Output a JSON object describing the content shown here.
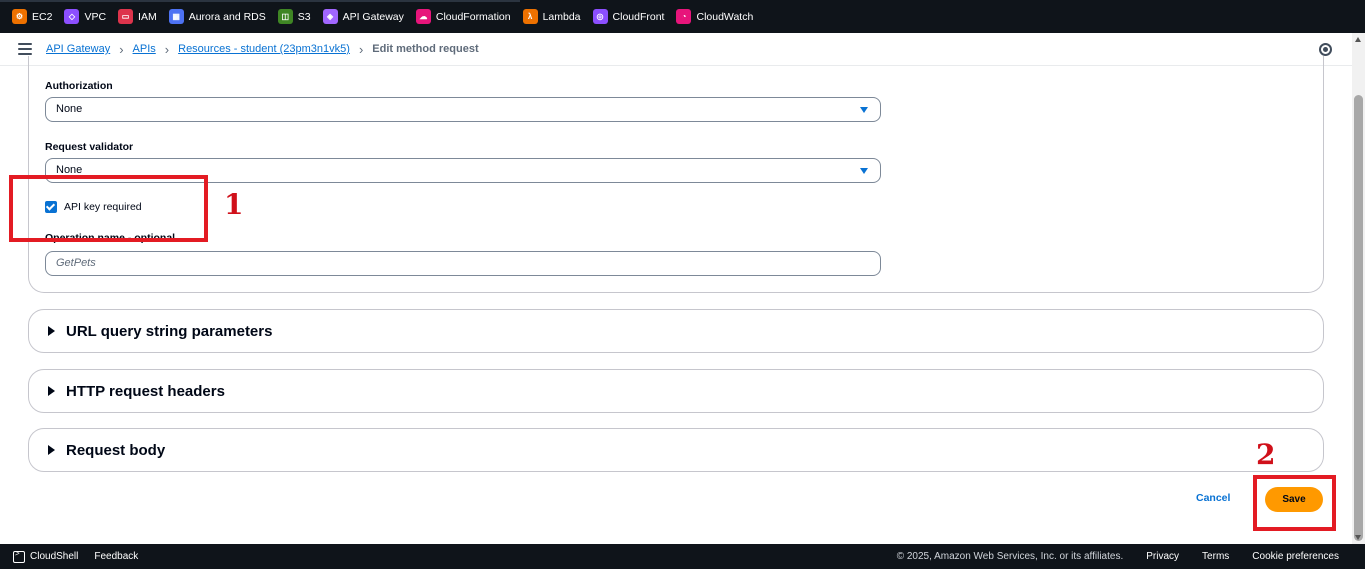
{
  "service_bar": {
    "items": [
      {
        "label": "EC2",
        "icon": "ec2-icon",
        "color": "#ed7100"
      },
      {
        "label": "VPC",
        "icon": "vpc-icon",
        "color": "#8c4fff"
      },
      {
        "label": "IAM",
        "icon": "iam-icon",
        "color": "#dd344c"
      },
      {
        "label": "Aurora and RDS",
        "icon": "rds-icon",
        "color": "#4d72f3"
      },
      {
        "label": "S3",
        "icon": "s3-icon",
        "color": "#3f8624"
      },
      {
        "label": "API Gateway",
        "icon": "api-gateway-icon",
        "color": "#a166ff"
      },
      {
        "label": "CloudFormation",
        "icon": "cloudformation-icon",
        "color": "#e7157b"
      },
      {
        "label": "Lambda",
        "icon": "lambda-icon",
        "color": "#ed7100"
      },
      {
        "label": "CloudFront",
        "icon": "cloudfront-icon",
        "color": "#8c4fff"
      },
      {
        "label": "CloudWatch",
        "icon": "cloudwatch-icon",
        "color": "#e7157b"
      }
    ]
  },
  "breadcrumb": {
    "items": [
      "API Gateway",
      "APIs",
      "Resources - student (23pm3n1vk5)"
    ],
    "current": "Edit method request"
  },
  "form": {
    "authorization_label": "Authorization",
    "authorization_value": "None",
    "validator_label": "Request validator",
    "validator_value": "None",
    "api_key_label": "API key required",
    "api_key_checked": true,
    "operation_label": "Operation name - optional",
    "operation_placeholder": "GetPets"
  },
  "sections": {
    "query": "URL query string parameters",
    "headers": "HTTP request headers",
    "body": "Request body"
  },
  "actions": {
    "cancel": "Cancel",
    "save": "Save"
  },
  "annotations": {
    "one": "1",
    "two": "2",
    "color": "#e31b23"
  },
  "footer": {
    "cloudshell": "CloudShell",
    "feedback": "Feedback",
    "copyright": "© 2025, Amazon Web Services, Inc. or its affiliates.",
    "privacy": "Privacy",
    "terms": "Terms",
    "cookies": "Cookie preferences"
  }
}
